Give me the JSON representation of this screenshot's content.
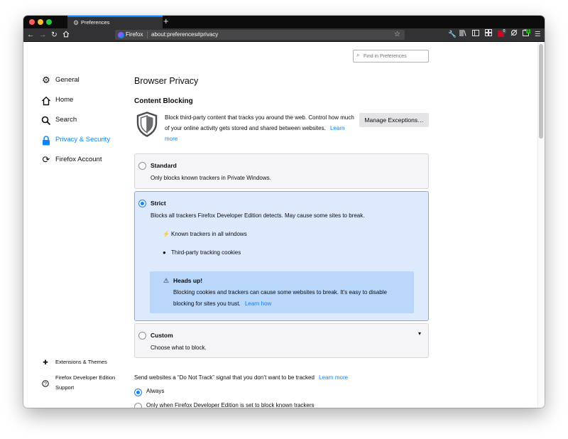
{
  "browser": {
    "tab_title": "Preferences",
    "identity_label": "Firefox",
    "url": "about:preferences#privacy",
    "toolbar_badges": [
      "0",
      "1"
    ]
  },
  "search": {
    "placeholder": "Find in Preferences"
  },
  "sidebar": {
    "items": [
      {
        "label": "General",
        "icon": "gear-icon"
      },
      {
        "label": "Home",
        "icon": "home-icon"
      },
      {
        "label": "Search",
        "icon": "search-icon"
      },
      {
        "label": "Privacy & Security",
        "icon": "lock-icon",
        "active": true
      },
      {
        "label": "Firefox Account",
        "icon": "sync-icon"
      }
    ],
    "footer": {
      "extensions": "Extensions & Themes",
      "support_line1": "Firefox Developer Edition",
      "support_line2": "Support"
    }
  },
  "main": {
    "heading": "Browser Privacy",
    "section_title": "Content Blocking",
    "description": "Block third-party content that tracks you around the web. Control how much of your online activity gets stored and shared between websites.",
    "learn_more": "Learn more",
    "manage_button": "Manage Exceptions…",
    "options": {
      "standard": {
        "title": "Standard",
        "desc": "Only blocks known trackers in Private Windows.",
        "selected": false
      },
      "strict": {
        "title": "Strict",
        "desc": "Blocks all trackers Firefox Developer Edition detects. May cause some sites to break.",
        "selected": true,
        "features": [
          "Known trackers in all windows",
          "Third-party tracking cookies"
        ],
        "warning": {
          "title": "Heads up!",
          "text": "Blocking cookies and trackers can cause some websites to break. It’s easy to disable blocking for sites you trust.",
          "link": "Learn how"
        }
      },
      "custom": {
        "title": "Custom",
        "desc": "Choose what to block.",
        "selected": false
      }
    },
    "dnt": {
      "label": "Send websites a “Do Not Track” signal that you don’t want to be tracked",
      "learn_more": "Learn more",
      "options": [
        "Always",
        "Only when Firefox Developer Edition is set to block known trackers"
      ],
      "selected": "Always"
    }
  },
  "colors": {
    "accent": "#0a84ff",
    "selected_card_bg": "#dde9fd",
    "warning_bg": "#b9d6fb",
    "titlebar": "#0c0c0d",
    "toolbar": "#323234"
  }
}
